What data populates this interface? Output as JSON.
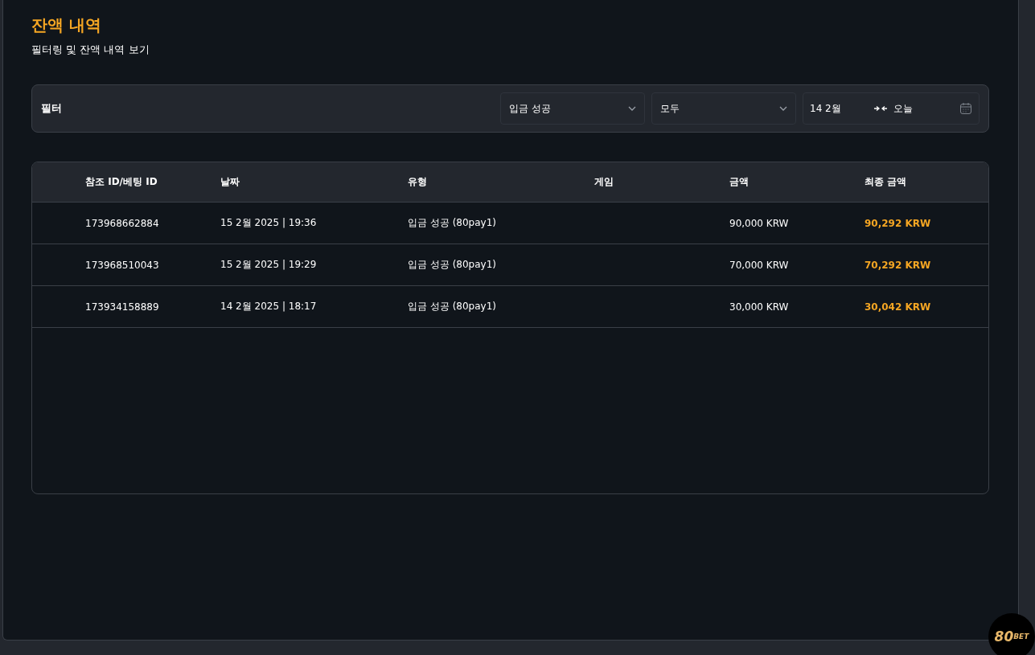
{
  "header": {
    "title": "잔액 내역",
    "subtitle": "필터링 및 잔액 내역 보기"
  },
  "filter": {
    "label": "필터",
    "selects": [
      {
        "value": "입금 성공"
      },
      {
        "value": "모두"
      }
    ],
    "date_range": {
      "from": "14 2월",
      "to": "오늘"
    }
  },
  "table": {
    "columns": [
      "참조 ID/베팅 ID",
      "날짜",
      "유형",
      "게임",
      "금액",
      "최종 금액"
    ],
    "rows": [
      {
        "cells": [
          "173968662884",
          "15 2월 2025 | 19:36",
          "입금 성공 (80pay1)",
          "",
          "90,000 KRW",
          "90,292 KRW"
        ]
      },
      {
        "cells": [
          "173968510043",
          "15 2월 2025 | 19:29",
          "입금 성공 (80pay1)",
          "",
          "70,000 KRW",
          "70,292 KRW"
        ]
      },
      {
        "cells": [
          "173934158889",
          "14 2월 2025 | 18:17",
          "입금 성공 (80pay1)",
          "",
          "30,000 KRW",
          "30,042 KRW"
        ]
      }
    ]
  },
  "logo": {
    "number": "80",
    "word": "BET"
  }
}
